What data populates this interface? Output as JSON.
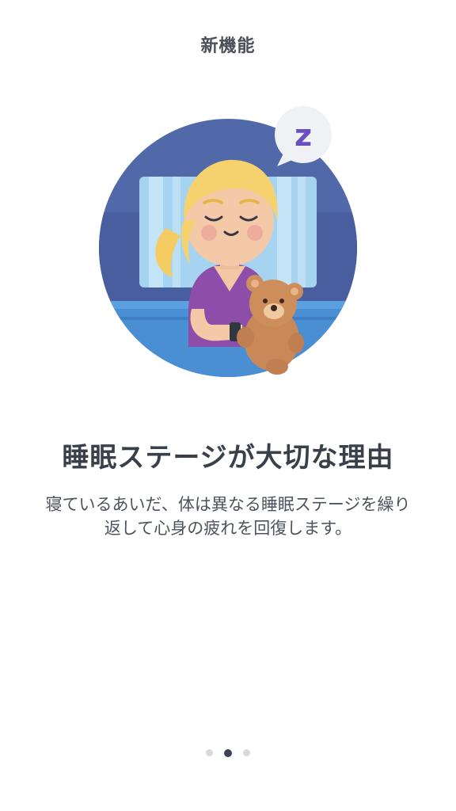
{
  "header": {
    "title": "新機能"
  },
  "illustration": {
    "icon": "sleeping-girl-with-teddy-bear-illustration",
    "bubble_letter": "z",
    "colors": {
      "circle": "#5067a8",
      "window": "#9fd0ef",
      "hair": "#f6d16d",
      "shirt": "#8d4fa8",
      "bear": "#c98a5a",
      "bubble_letter": "#6a4fc1"
    }
  },
  "content": {
    "headline": "睡眠ステージが大切な理由",
    "body_line1": "寝ているあいだ、体は異なる睡眠ステージを繰り",
    "body_line2": "返して心身の疲れを回復します。"
  },
  "pager": {
    "total": 3,
    "active_index": 1
  }
}
